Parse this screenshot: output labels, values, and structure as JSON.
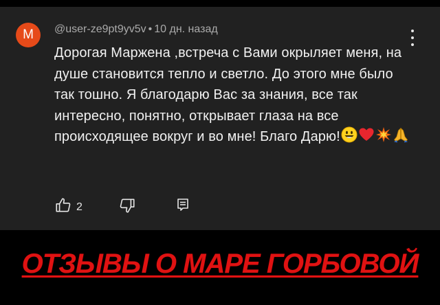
{
  "comment": {
    "avatar_letter": "M",
    "avatar_color": "#e64a19",
    "author": "@user-ze9pt9yv5v",
    "separator": "•",
    "time": "10 дн. назад",
    "text": "Дорогая Маржена ,встреча с Вами окрыляет меня, на душе становится тепло и светло. До этого мне было так тошно. Я благодарю Вас за знания, все так интересно, понятно, открывает глаза на все происходящее вокруг и во мне! Благо Дарю!",
    "emojis": [
      "smiling-face-emoji",
      "red-heart-emoji",
      "collision-emoji",
      "folded-hands-emoji"
    ],
    "likes": "2",
    "icons": {
      "like": "thumbs-up-icon",
      "dislike": "thumbs-down-icon",
      "reply": "reply-comment-icon",
      "menu": "more-vertical-icon"
    }
  },
  "banner": {
    "text": "ОТЗЫВЫ О МАРЕ ГОРБОВОЙ",
    "color": "#e01212"
  },
  "colors": {
    "card_bg": "#212121",
    "page_bg": "#000000",
    "text": "#f1f1f1",
    "meta": "#aaaaaa"
  }
}
